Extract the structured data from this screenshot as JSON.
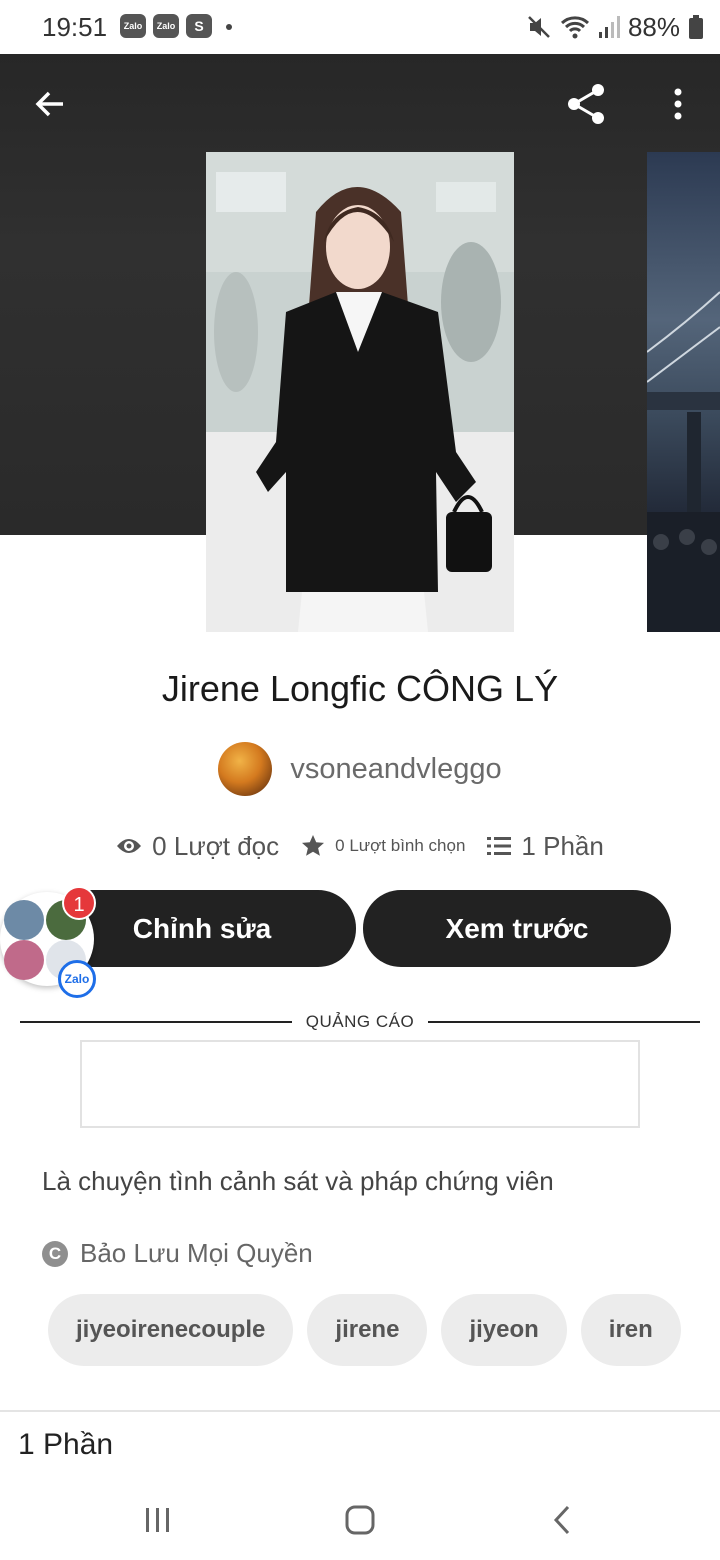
{
  "status_bar": {
    "time": "19:51",
    "apps": [
      "Zalo",
      "Zalo",
      "S"
    ],
    "battery": "88%",
    "icons": [
      "mute-icon",
      "wifi-icon",
      "signal-icon",
      "battery-icon"
    ]
  },
  "header": {
    "icons": [
      "back-arrow-icon",
      "share-icon",
      "more-vert-icon"
    ]
  },
  "story": {
    "title": "Jirene Longfic CÔNG LÝ",
    "author": "vsoneandvleggo",
    "reads": "0 Lượt đọc",
    "votes": "0 Lượt bình chọn",
    "parts": "1 Phần"
  },
  "actions": {
    "edit_label": "Chỉnh sửa",
    "preview_label": "Xem trước"
  },
  "chat_head": {
    "badge_count": "1",
    "brand": "Zalo"
  },
  "ad": {
    "label": "QUẢNG CÁO"
  },
  "description": "Là chuyện tình cảnh sát và pháp chứng viên",
  "copyright": {
    "symbol": "C",
    "text": "Bảo Lưu Mọi Quyền"
  },
  "tags": [
    "jiyeoirenecouple",
    "jirene",
    "jiyeon",
    "iren"
  ],
  "footer": {
    "parts_label": "1 Phần"
  },
  "colors": {
    "button_bg": "#222222",
    "hero_bg": "#2a2a2a",
    "tag_bg": "#ececec",
    "badge_red": "#e5383b",
    "zalo_blue": "#1e6ee8"
  }
}
